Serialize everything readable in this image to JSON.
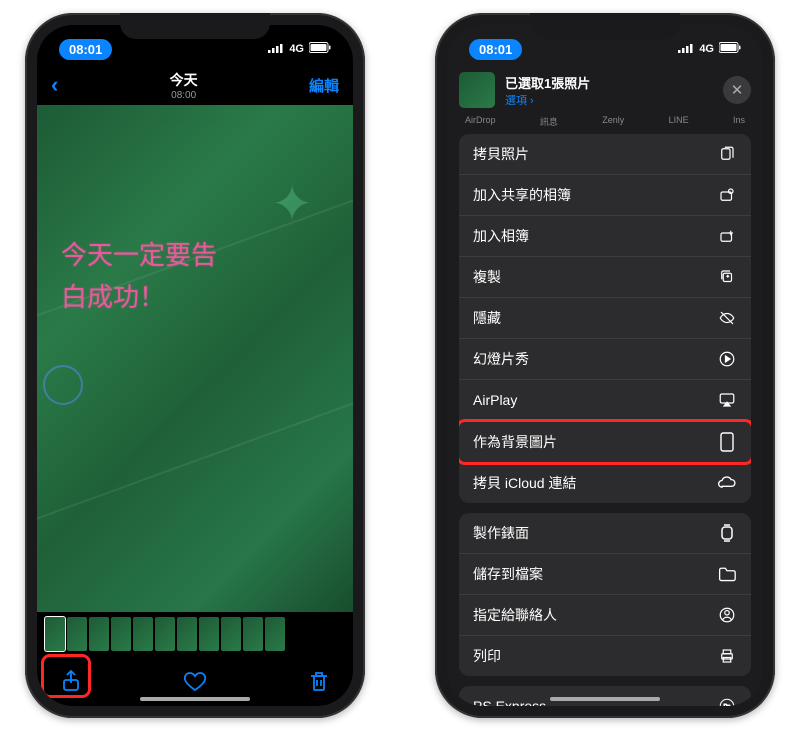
{
  "status": {
    "time": "08:01",
    "network": "4G"
  },
  "left": {
    "nav": {
      "title": "今天",
      "subtitle": "08:00",
      "edit": "編輯"
    },
    "photo_text_line1": "今天一定要告",
    "photo_text_line2": "白成功！"
  },
  "right": {
    "header": {
      "title": "已選取1張照片",
      "options": "選項 ›"
    },
    "apps": [
      "AirDrop",
      "訊息",
      "Zenly",
      "LINE",
      "Ins"
    ],
    "group1": [
      {
        "label": "拷貝照片",
        "icon": "copy-photo"
      },
      {
        "label": "加入共享的相簿",
        "icon": "shared-album"
      },
      {
        "label": "加入相簿",
        "icon": "add-album"
      },
      {
        "label": "複製",
        "icon": "duplicate"
      },
      {
        "label": "隱藏",
        "icon": "hide"
      },
      {
        "label": "幻燈片秀",
        "icon": "slideshow"
      },
      {
        "label": "AirPlay",
        "icon": "airplay"
      },
      {
        "label": "作為背景圖片",
        "icon": "wallpaper",
        "highlight": true
      },
      {
        "label": "拷貝 iCloud 連結",
        "icon": "icloud-link"
      }
    ],
    "group2": [
      {
        "label": "製作錶面",
        "icon": "watchface"
      },
      {
        "label": "儲存到檔案",
        "icon": "save-files"
      },
      {
        "label": "指定給聯絡人",
        "icon": "assign-contact"
      },
      {
        "label": "列印",
        "icon": "print"
      }
    ],
    "group3": [
      {
        "label": "PS Express",
        "icon": "ps-express"
      }
    ]
  }
}
